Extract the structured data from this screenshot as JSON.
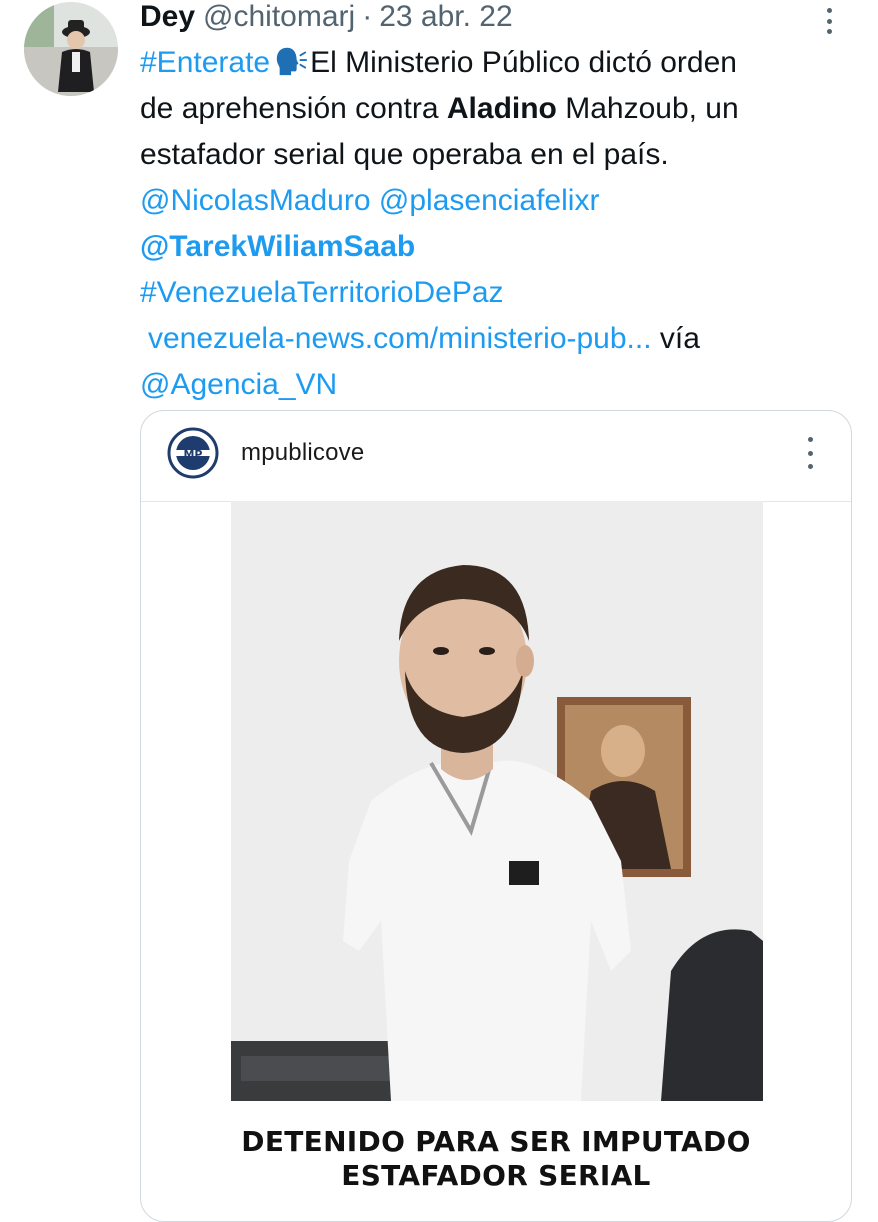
{
  "tweet": {
    "author_name": "Dey",
    "author_handle": "@chitomarj",
    "separator": "·",
    "date": "23 abr. 22",
    "avatar_icon": "user-avatar",
    "more_icon": "more-options-icon",
    "text": {
      "hashtag_enterate": "#Enterate",
      "emoji_icon": "speaking-head-icon",
      "line1_rest": "El Ministerio Público dictó orden",
      "line2_start": "de aprehensión contra ",
      "line2_bold": "Aladino",
      "line2_end": " Mahzoub, un",
      "line3": "estafador serial que operaba en el país.",
      "mention1": "@NicolasMaduro",
      "mention2": "@plasenciafelixr",
      "mention3": "@TarekWiliamSaab",
      "hashtag2": "#VenezuelaTerritorioDePaz",
      "url": "venezuela-news.com/ministerio-pub...",
      "via": " vía",
      "mention4": "@Agencia_VN"
    },
    "media_card": {
      "username": "mpublicove",
      "logo_icon": "ministerio-publico-logo",
      "more_icon": "more-options-icon",
      "caption_line1": "DETENIDO PARA SER IMPUTADO",
      "caption_line2": "ESTAFADOR SERIAL"
    }
  },
  "colors": {
    "link": "#1d9bf0",
    "text": "#0f1419",
    "secondary": "#536471",
    "border": "#cfd9de"
  }
}
